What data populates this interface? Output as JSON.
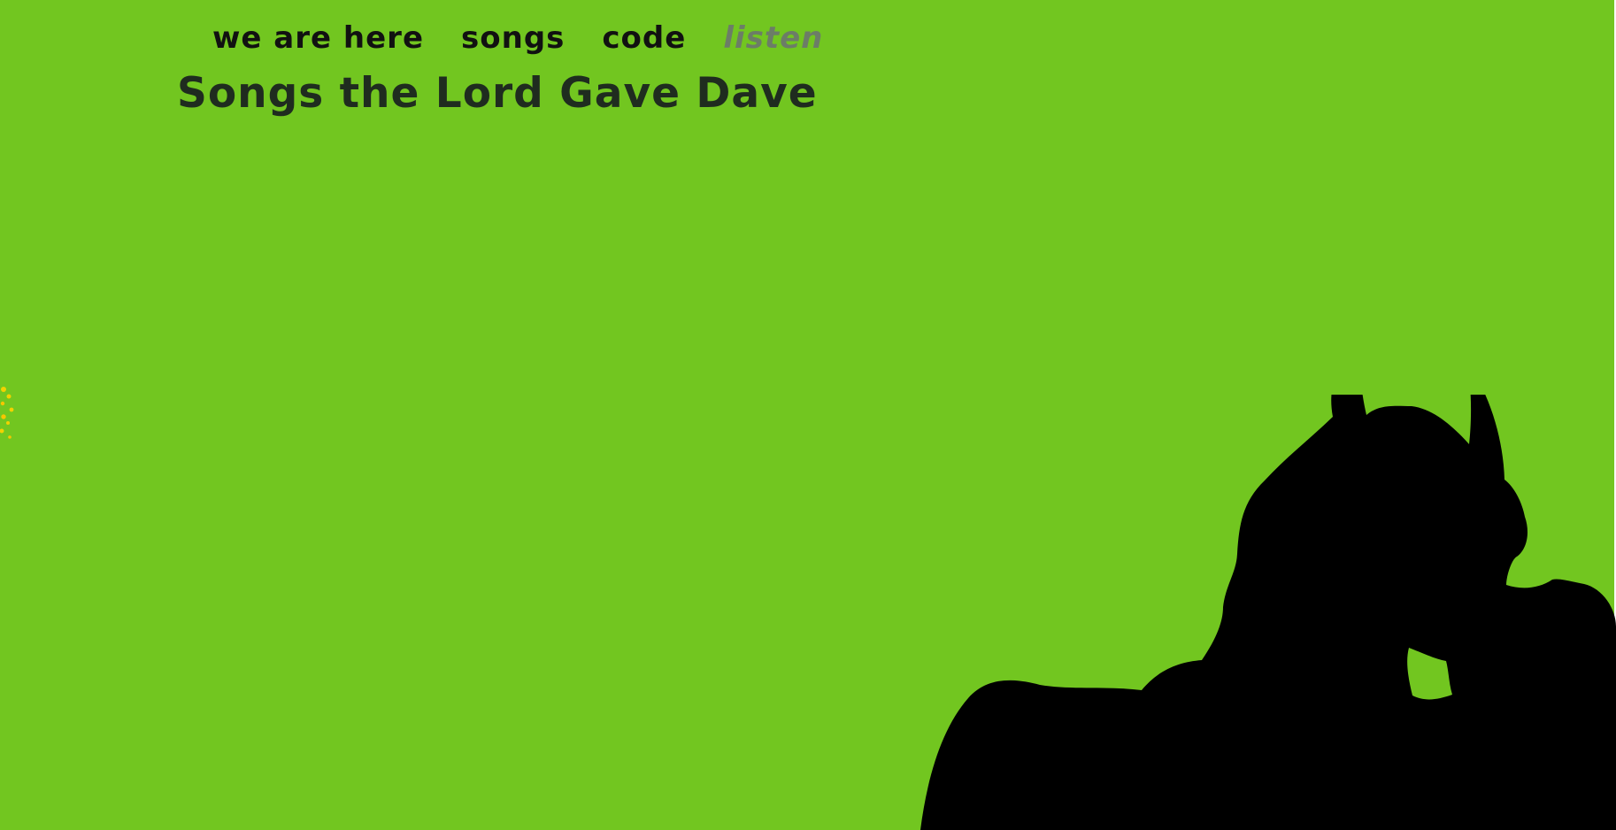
{
  "nav": {
    "items": [
      {
        "label": "we are here",
        "current": false
      },
      {
        "label": "songs",
        "current": false
      },
      {
        "label": "code",
        "current": false
      },
      {
        "label": "listen",
        "current": true
      }
    ]
  },
  "page": {
    "title": "Songs the Lord Gave Dave"
  },
  "colors": {
    "background": "#72c620",
    "text": "#111111",
    "active_nav": "#6c7d67",
    "silhouette": "#000000",
    "sparkles": "#f2d200"
  },
  "images": {
    "silhouette": "devil-silhouette",
    "sparkles": "sparkle-cluster"
  }
}
